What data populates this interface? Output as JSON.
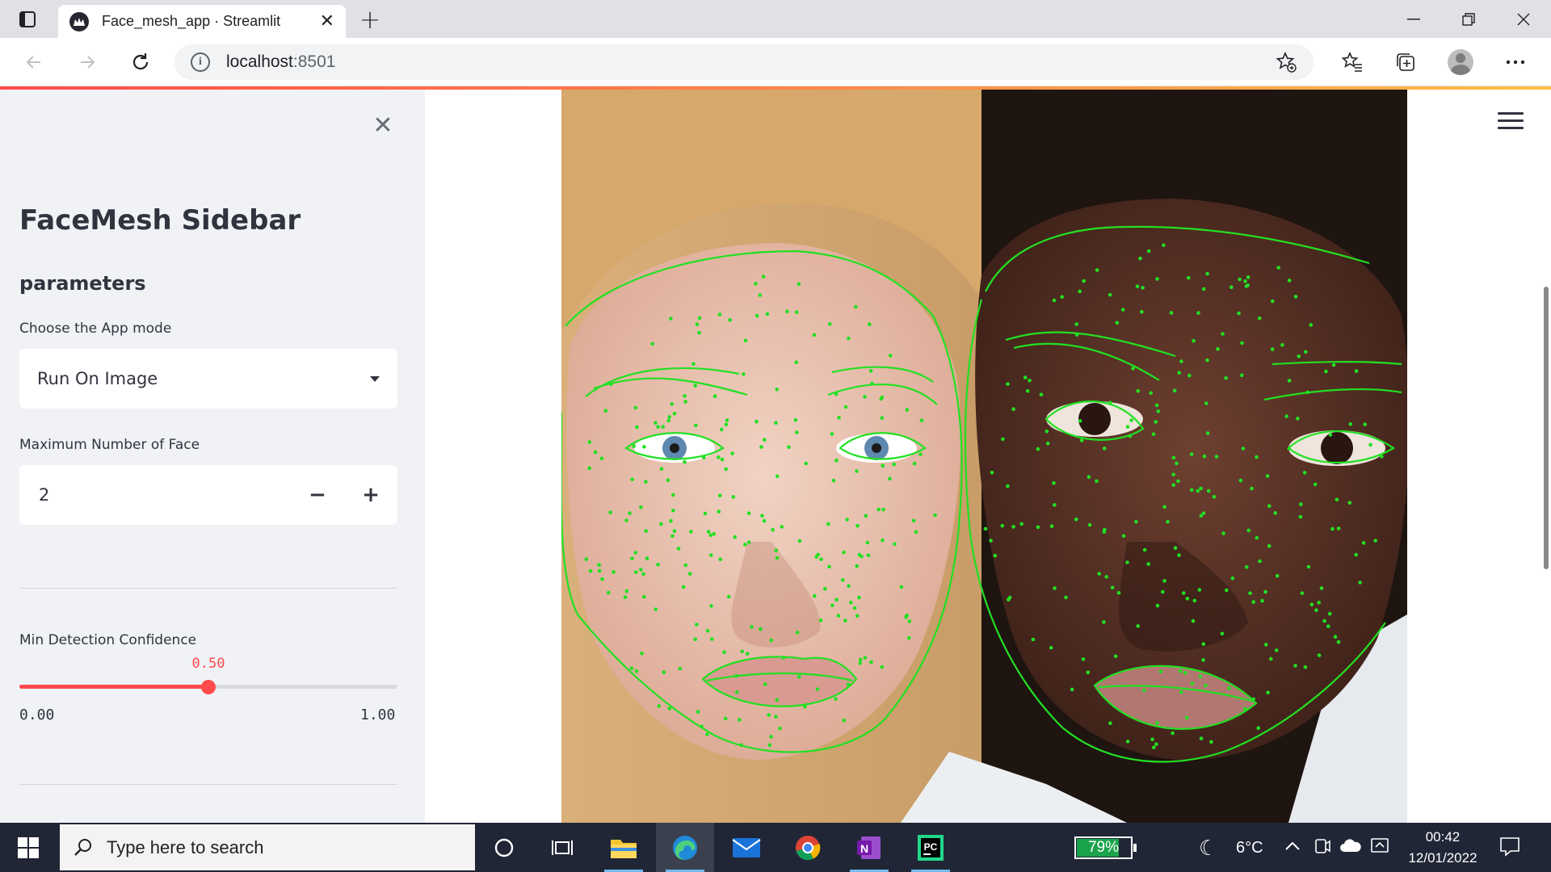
{
  "browser": {
    "tab_title": "Face_mesh_app · Streamlit",
    "url_host": "localhost",
    "url_port": ":8501"
  },
  "sidebar": {
    "title": "FaceMesh Sidebar",
    "subtitle": "parameters",
    "app_mode_label": "Choose the App mode",
    "app_mode_value": "Run On Image",
    "max_faces_label": "Maximum Number of Face",
    "max_faces_value": "2",
    "confidence_label": "Min Detection Confidence",
    "confidence_value": "0.50",
    "confidence_fraction": 0.5,
    "confidence_min": "0.00",
    "confidence_max": "1.00"
  },
  "taskbar": {
    "search_placeholder": "Type here to search",
    "battery": "79%",
    "battery_fraction": 0.79,
    "temperature": "6°C",
    "time": "00:42",
    "date": "12/01/2022"
  },
  "colors": {
    "accent": "#ff4b4b",
    "mesh": "#22e022",
    "sidebar_bg": "#f0f2f6"
  }
}
